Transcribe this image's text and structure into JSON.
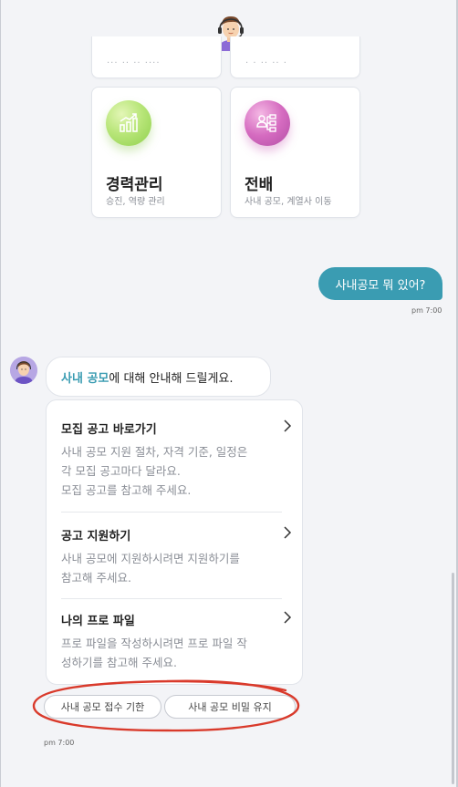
{
  "top_cards": {
    "stub_left_text": "··· ·· ·· ····",
    "stub_right_text": "· · ·· ·· ·",
    "career": {
      "title": "경력관리",
      "subtitle": "승진, 역량 관리",
      "icon": "growth-chart-icon"
    },
    "transfer": {
      "title": "전배",
      "subtitle": "사내 공모, 계열사 이동",
      "icon": "org-chart-icon"
    }
  },
  "conversation": {
    "user_message": "사내공모 뭐 있어?",
    "user_time": "pm 7:00",
    "bot_intro_highlight": "사내 공모",
    "bot_intro_rest": "에 대해 안내해 드릴게요.",
    "bot_time": "pm 7:00"
  },
  "list": [
    {
      "title": "모집 공고 바로가기",
      "desc": [
        "사내 공모 지원 절차, 자격 기준, 일정은",
        "각 모집 공고마다 달라요.",
        "모집 공고를 참고해 주세요."
      ]
    },
    {
      "title": "공고 지원하기",
      "desc": [
        "사내 공모에 지원하시려면 지원하기를",
        "참고해 주세요."
      ]
    },
    {
      "title": "나의 프로 파일",
      "desc": [
        "프로 파일을 작성하시려면 프로 파일 작",
        "성하기를 참고해 주세요."
      ]
    }
  ],
  "chips": [
    "사내 공모 접수 기한",
    "사내 공모 비밀 유지"
  ],
  "colors": {
    "accent": "#3a9cb2",
    "annotation_red": "#d93a2b"
  }
}
